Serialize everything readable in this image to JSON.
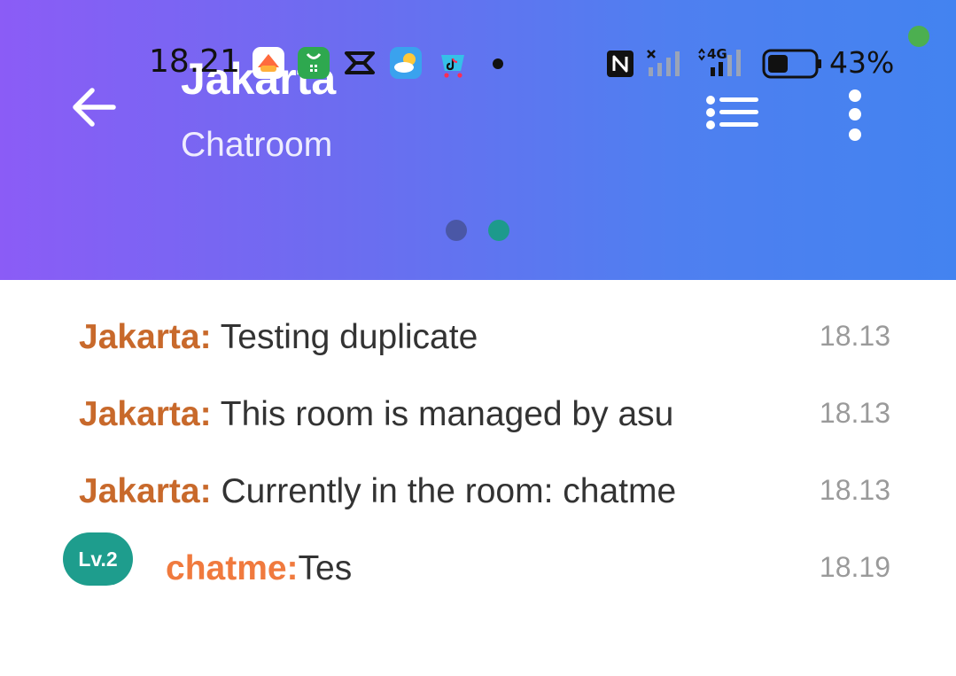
{
  "status_bar": {
    "time": "18.21",
    "battery_percent": "43%",
    "network": "4G",
    "battery_level": 0.43,
    "app_icons": [
      "game-app-icon",
      "shopping-bag-icon",
      "capcut-icon",
      "weather-icon",
      "tiktok-shop-icon"
    ]
  },
  "header": {
    "title": "Jakarta",
    "subtitle": "Chatroom",
    "active_page": 2,
    "page_count": 2
  },
  "messages": [
    {
      "sender": "Jakarta:",
      "text": "Testing duplicate",
      "time": "18.13"
    },
    {
      "sender": "Jakarta:",
      "text": "This room is managed by asu",
      "time": "18.13"
    },
    {
      "sender": "Jakarta:",
      "text": "Currently in the room: chatme",
      "time": "18.13"
    }
  ],
  "user_message": {
    "level": "Lv.2",
    "sender": "chatme:",
    "text": "Tes",
    "time": "18.19"
  },
  "colors": {
    "header_gradient_start": "#8b5cf6",
    "header_gradient_end": "#4383f0",
    "system_sender": "#c8692b",
    "user_sender": "#f07a3e",
    "level_badge": "#1e9d8d"
  }
}
